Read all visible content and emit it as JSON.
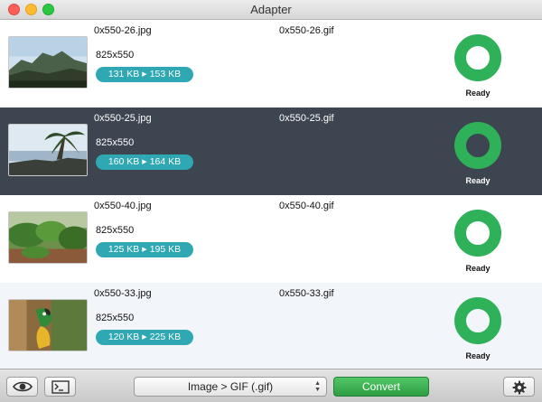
{
  "window": {
    "title": "Adapter"
  },
  "items": [
    {
      "source_name": "0x550-26.jpg",
      "dimensions": "825x550",
      "size_in": "131 KB",
      "size_out": "153 KB",
      "output_name": "0x550-26.gif",
      "status": "Ready",
      "progress": 1.0,
      "thumbnail": "mountain-landscape-photo"
    },
    {
      "source_name": "0x550-25.jpg",
      "dimensions": "825x550",
      "size_in": "160 KB",
      "size_out": "164 KB",
      "output_name": "0x550-25.gif",
      "status": "Ready",
      "progress": 1.0,
      "thumbnail": "palm-beach-photo"
    },
    {
      "source_name": "0x550-40.jpg",
      "dimensions": "825x550",
      "size_in": "125 KB",
      "size_out": "195 KB",
      "output_name": "0x550-40.gif",
      "status": "Ready",
      "progress": 1.0,
      "thumbnail": "green-plants-photo"
    },
    {
      "source_name": "0x550-33.jpg",
      "dimensions": "825x550",
      "size_in": "120 KB",
      "size_out": "225 KB",
      "output_name": "0x550-33.gif",
      "status": "Ready",
      "progress": 1.0,
      "thumbnail": "parrot-photo"
    }
  ],
  "toolbar": {
    "preview_icon": "eye-icon",
    "log_icon": "terminal-icon",
    "format_value": "Image > GIF (.gif)",
    "convert_label": "Convert",
    "settings_icon": "gear-icon"
  },
  "colors": {
    "selected_row": "#3c4550",
    "size_pill": "#2fa8b3",
    "ready_ring": "#2fb15a",
    "convert_button": "#3aae50"
  }
}
